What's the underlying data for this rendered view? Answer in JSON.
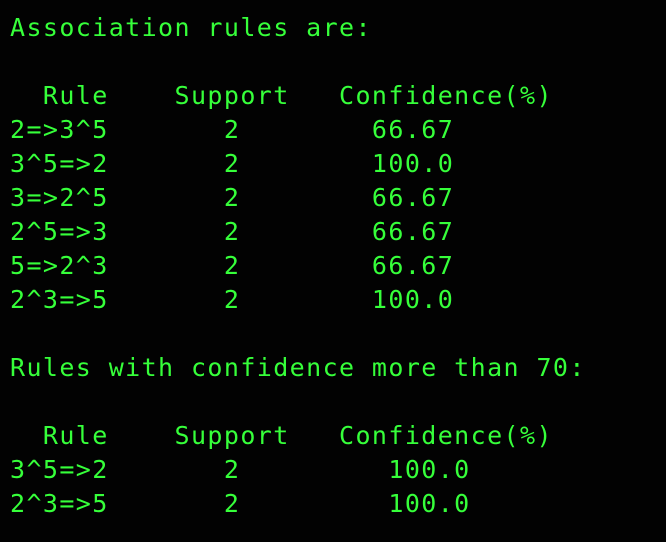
{
  "theme": {
    "background": "#020202",
    "foreground": "#36ff3a"
  },
  "terminal": {
    "lines": [
      "Association rules are:",
      "",
      "  Rule    Support   Confidence(%)",
      "2=>3^5       2        66.67",
      "3^5=>2       2        100.0",
      "3=>2^5       2        66.67",
      "2^5=>3       2        66.67",
      "5=>2^3       2        66.67",
      "2^3=>5       2        100.0",
      "",
      "Rules with confidence more than 70:",
      "",
      "  Rule    Support   Confidence(%)",
      "3^5=>2       2         100.0",
      "2^3=>5       2         100.0"
    ]
  }
}
